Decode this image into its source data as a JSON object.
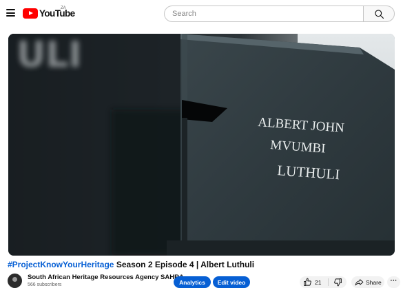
{
  "header": {
    "logo_text": "YouTube",
    "country_code": "ZA",
    "search_placeholder": "Search",
    "icons": [
      "menu-icon",
      "youtube-logo-icon",
      "search-icon"
    ]
  },
  "video": {
    "inscription_lines": [
      "ALBERT JOHN",
      "MVUMBI",
      "LUTHULI"
    ],
    "blurred_text": "ULI"
  },
  "title": {
    "hashtag": "#ProjectKnowYourHeritage",
    "rest": " Season 2 Episode 4 | Albert Luthuli"
  },
  "channel": {
    "name": "South African Heritage Resources Agency SAHRA",
    "subscribers": "566 subscribers"
  },
  "actions": {
    "analytics_label": "Analytics",
    "edit_label": "Edit video",
    "like_count": "21",
    "share_label": "Share",
    "more_label": "···"
  },
  "colors": {
    "brand_red": "#ff0000",
    "accent_blue": "#065fd4",
    "chip_bg": "#f2f2f2"
  }
}
